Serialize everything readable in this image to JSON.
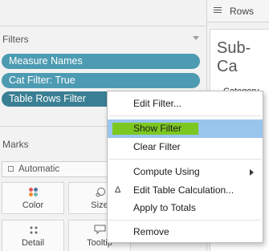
{
  "rows_shelf": {
    "label": "Rows"
  },
  "filters": {
    "header": "Filters",
    "pills": [
      "Measure Names",
      "Cat Filter: True",
      "Table Rows Filter"
    ]
  },
  "marks": {
    "header": "Marks",
    "type_select": "Automatic",
    "cards": [
      {
        "label": "Color"
      },
      {
        "label": "Size"
      },
      {
        "label": "Detail"
      },
      {
        "label": "Tooltip"
      }
    ]
  },
  "sheet": {
    "title": "Sub-Ca",
    "category": "Category"
  },
  "context_menu": {
    "items": [
      {
        "label": "Edit Filter..."
      },
      {
        "label": "Show Filter",
        "highlighted": true
      },
      {
        "label": "Clear Filter"
      },
      {
        "label": "Compute Using",
        "submenu": true
      },
      {
        "label": "Edit Table Calculation...",
        "icon": "delta-icon"
      },
      {
        "label": "Apply to Totals"
      },
      {
        "label": "Remove"
      }
    ]
  },
  "colors": {
    "pill": "#4d9bb2",
    "pill_selected": "#3a7f93",
    "menu_highlight": "#99c5ed",
    "annotation_mark": "#7dc820"
  }
}
